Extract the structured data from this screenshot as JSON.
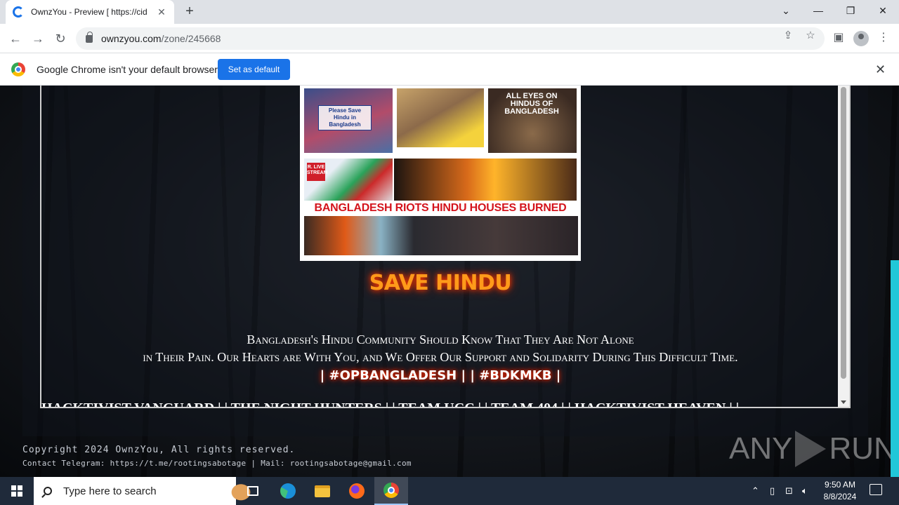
{
  "browser": {
    "tab_title": "OwnzYou - Preview [ https://cid",
    "url_host": "ownzyou.com",
    "url_path": "/zone/245668",
    "infobar_text": "Google Chrome isn't your default browser",
    "infobar_button": "Set as default"
  },
  "collage": {
    "sign_text": "Please Save Hindu in Bangladesh",
    "live_badge": "R. LIVE STREAM",
    "all_eyes_caption": "ALL EYES ON HINDUS OF BANGLADESH",
    "banner": "BANGLADESH RIOTS HINDU HOUSES BURNED"
  },
  "content": {
    "heading": "SAVE HINDU",
    "message_line1": "Bangladesh's Hindu Community Should Know That They Are Not Alone",
    "message_line2": "in Their Pain. Our Hearts are With You, and We Offer Our Support and Solidarity During This Difficult Time.",
    "hashtags": "| #OPBANGLADESH | | #BDKMKB |",
    "marquee": "HACKTIVIST VANGUARD | | THE NIGHT HUNTERS | | TEAM UCC | | TEAM 404 | | HACKTIVIST HEAVEN | |"
  },
  "footer": {
    "copyright": "Copyright 2024 OwnzYou, All rights reserved.",
    "contact": "Contact Telegram: https://t.me/rootingsabotage | Mail: rootingsabotage@gmail.com"
  },
  "watermark": {
    "left": "ANY",
    "right": "RUN"
  },
  "taskbar": {
    "search_placeholder": "Type here to search",
    "time": "9:50 AM",
    "date": "8/8/2024"
  }
}
